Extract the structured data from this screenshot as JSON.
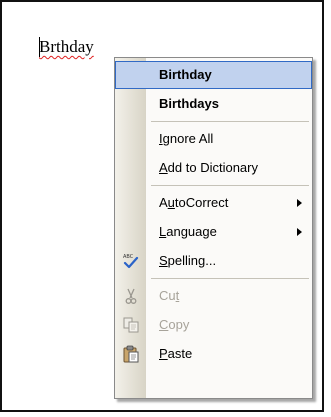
{
  "document": {
    "misspelled_word": "Brthday"
  },
  "context_menu": {
    "suggestions": [
      {
        "label": "Birthday",
        "selected": true
      },
      {
        "label": "Birthdays",
        "selected": false
      }
    ],
    "items": {
      "ignore_all": {
        "pre": "",
        "key": "I",
        "post": "gnore All"
      },
      "add_to_dictionary": {
        "pre": "",
        "key": "A",
        "post": "dd to Dictionary"
      },
      "autocorrect": {
        "pre": "A",
        "key": "u",
        "post": "toCorrect"
      },
      "language": {
        "pre": "",
        "key": "L",
        "post": "anguage"
      },
      "spelling": {
        "pre": "",
        "key": "S",
        "post": "pelling..."
      },
      "cut": {
        "pre": "Cu",
        "key": "t",
        "post": "",
        "enabled": false
      },
      "copy": {
        "pre": "",
        "key": "C",
        "post": "opy",
        "enabled": false
      },
      "paste": {
        "pre": "",
        "key": "P",
        "post": "aste",
        "enabled": true
      }
    },
    "icons": {
      "spelling": "abc-check-icon",
      "cut": "scissors-icon",
      "copy": "copy-icon",
      "paste": "paste-clipboard-icon"
    },
    "colors": {
      "selection_fill": "#c1d2ee",
      "selection_border": "#316ac5",
      "disabled_text": "#a7a39a",
      "squiggle": "#e02020"
    }
  }
}
